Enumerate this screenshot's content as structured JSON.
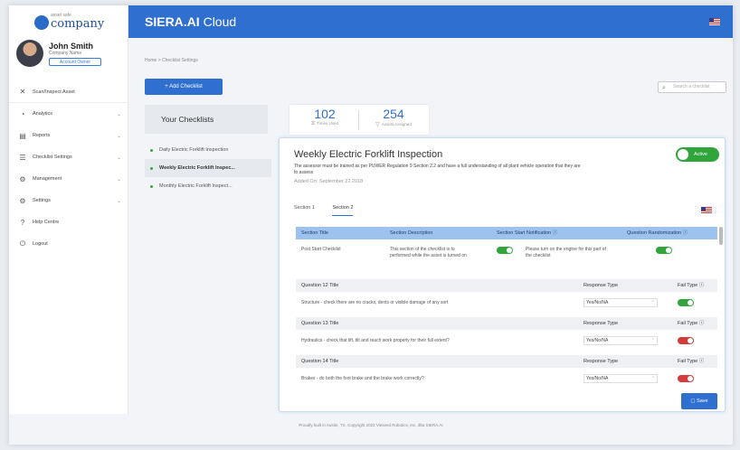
{
  "app": {
    "brand_bold": "SIERA.AI",
    "brand_rest": " Cloud"
  },
  "logo": {
    "small": "asset safe",
    "big": "company"
  },
  "profile": {
    "name": "John Smith",
    "company": "Company Name",
    "button": "Account Owner"
  },
  "nav": [
    {
      "label": "Scan/Inspect Asset",
      "icon": "✕"
    },
    {
      "label": "Analytics",
      "icon": "◔",
      "chevron": "⌄"
    },
    {
      "label": "Reports",
      "icon": "▤",
      "chevron": "⌄"
    },
    {
      "label": "Checklist Settings",
      "icon": "☰",
      "chevron": "⌄"
    },
    {
      "label": "Management",
      "icon": "⚙",
      "chevron": "⌄"
    },
    {
      "label": "Settings",
      "icon": "⚙",
      "chevron": "⌄"
    },
    {
      "label": "Help Centre",
      "icon": "?"
    },
    {
      "label": "Logout",
      "icon": "⏻"
    }
  ],
  "breadcrumb": "Home  >  Checklist Settings",
  "add_button": "+  Add Checklist",
  "search": {
    "placeholder": "Search a checklist"
  },
  "your_checklists": "Your Checklists",
  "checklists": [
    {
      "label": "Daily Electric Forklift Inspection",
      "selected": false
    },
    {
      "label": "Weekly Electric Forklift Inspec...",
      "selected": true
    },
    {
      "label": "Monthly Electric Forklift Inspect...",
      "selected": false
    }
  ],
  "stats": [
    {
      "value": "102",
      "label": "Times Used",
      "icon": "⧖"
    },
    {
      "value": "254",
      "label": "Assets Assigned",
      "icon": "▽"
    }
  ],
  "card": {
    "title": "Weekly Electric Forklift Inspection",
    "description": "The assessor must be trained as per PUWER Regulation 9 Section 2.2 and have a full understanding of all plant vehicle operation that they are to assess",
    "added": "Added On: September 22 2018",
    "active_label": "Active",
    "tabs": [
      "Section 1",
      "Section 2"
    ],
    "section_headers": [
      "Section Title",
      "Section Description",
      "Section Start Notification ⓘ",
      "Question Randomization ⓘ"
    ],
    "section_row": {
      "title": "Post Start Checklist",
      "description": "This section of the checklist is to performed while the asset is turned on",
      "notification": "Please turn on the engine for this part of the checklist",
      "toggle_label": "Yes"
    },
    "q_headers": {
      "response": "Response Type",
      "fail": "Fail Type ⓘ"
    },
    "questions": [
      {
        "title": "Question 12 Title",
        "text": "Structure - check there are no cracks, dents or visible damage of any sort",
        "response": "Yes/No/NA",
        "fail": "Yes"
      },
      {
        "title": "Question 13 Title",
        "text": "Hydraulics - check that lift, tilt and reach work properly for their full extent?",
        "response": "Yes/No/NA",
        "fail": "No"
      },
      {
        "title": "Question 14 Title",
        "text": "Brakes - do both the foot brake and the brake work correctly?",
        "response": "Yes/No/NA",
        "fail": "No"
      }
    ],
    "save": "▢  Save"
  },
  "footer": "Proudly built in Austin, TX. Copyright 2022 Vieseed Robotics, Inc. dba SIERA.AI"
}
